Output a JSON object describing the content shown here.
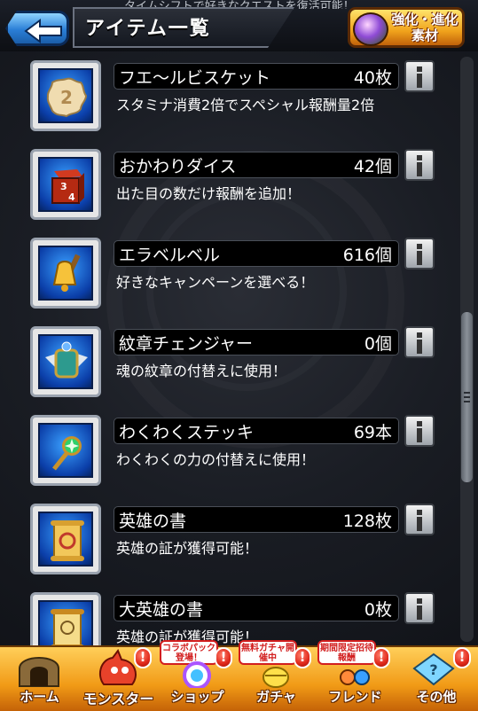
{
  "header": {
    "title": "アイテム一覧",
    "top_hint": "タイムシフトで好きなクエストを復活可能！",
    "material_button_label": "強化・進化素材"
  },
  "items": [
    {
      "name": "フエ～ルビスケット",
      "count": "40枚",
      "desc": "スタミナ消費2倍でスペシャル報酬量2倍",
      "icon": "biscuit-icon"
    },
    {
      "name": "おかわりダイス",
      "count": "42個",
      "desc": "出た目の数だけ報酬を追加！",
      "icon": "dice-icon"
    },
    {
      "name": "エラベルベル",
      "count": "616個",
      "desc": "好きなキャンペーンを選べる！",
      "icon": "bell-icon"
    },
    {
      "name": "紋章チェンジャー",
      "count": "0個",
      "desc": "魂の紋章の付替えに使用！",
      "icon": "emblem-icon"
    },
    {
      "name": "わくわくステッキ",
      "count": "69本",
      "desc": "わくわくの力の付替えに使用！",
      "icon": "wand-icon"
    },
    {
      "name": "英雄の書",
      "count": "128枚",
      "desc": "英雄の証が獲得可能！",
      "icon": "scroll-icon"
    },
    {
      "name": "大英雄の書",
      "count": "0枚",
      "desc": "英雄の証が獲得可能！",
      "icon": "great-scroll-icon"
    }
  ],
  "tabs": [
    {
      "label": "ホーム",
      "icon": "home-icon"
    },
    {
      "label": "モンスター",
      "icon": "monster-icon",
      "alert": "!"
    },
    {
      "label": "ショップ",
      "icon": "shop-icon",
      "badge": "コラボパック登場！",
      "alert": "!"
    },
    {
      "label": "ガチャ",
      "icon": "gacha-icon",
      "badge": "無料ガチャ開催中",
      "alert": "!"
    },
    {
      "label": "フレンド",
      "icon": "friend-icon",
      "badge": "期間限定招待報酬",
      "alert": "!"
    },
    {
      "label": "その他",
      "icon": "other-icon",
      "alert": "!"
    }
  ],
  "colors": {
    "item_icon_bg": "#1456c8",
    "tabbar": "#f19a16",
    "back_button": "#2a7ed6"
  }
}
